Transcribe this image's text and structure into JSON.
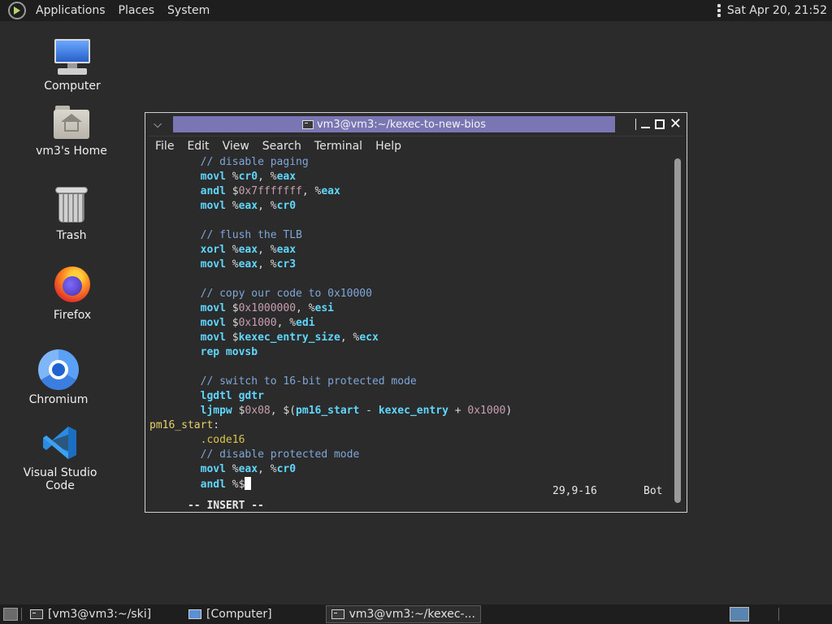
{
  "top_panel": {
    "menus": [
      "Applications",
      "Places",
      "System"
    ],
    "clock": "Sat Apr 20, 21:52"
  },
  "desktop_icons": {
    "computer": "Computer",
    "home": "vm3's Home",
    "trash": "Trash",
    "firefox": "Firefox",
    "chromium": "Chromium",
    "vscode": "Visual Studio Code"
  },
  "terminal": {
    "title": "vm3@vm3:~/kexec-to-new-bios",
    "menu": [
      "File",
      "Edit",
      "View",
      "Search",
      "Terminal",
      "Help"
    ],
    "lines": [
      [
        {
          "t": "        ",
          "c": "plain"
        },
        {
          "t": "// disable paging",
          "c": "comment"
        }
      ],
      [
        {
          "t": "        ",
          "c": "plain"
        },
        {
          "t": "movl",
          "c": "kw"
        },
        {
          "t": " %",
          "c": "plain"
        },
        {
          "t": "cr0",
          "c": "reg"
        },
        {
          "t": ", %",
          "c": "plain"
        },
        {
          "t": "eax",
          "c": "reg"
        }
      ],
      [
        {
          "t": "        ",
          "c": "plain"
        },
        {
          "t": "andl",
          "c": "kw"
        },
        {
          "t": " $",
          "c": "plain"
        },
        {
          "t": "0x7fffffff",
          "c": "num"
        },
        {
          "t": ", %",
          "c": "plain"
        },
        {
          "t": "eax",
          "c": "reg"
        }
      ],
      [
        {
          "t": "        ",
          "c": "plain"
        },
        {
          "t": "movl",
          "c": "kw"
        },
        {
          "t": " %",
          "c": "plain"
        },
        {
          "t": "eax",
          "c": "reg"
        },
        {
          "t": ", %",
          "c": "plain"
        },
        {
          "t": "cr0",
          "c": "reg"
        }
      ],
      [],
      [
        {
          "t": "        ",
          "c": "plain"
        },
        {
          "t": "// flush the TLB",
          "c": "comment"
        }
      ],
      [
        {
          "t": "        ",
          "c": "plain"
        },
        {
          "t": "xorl",
          "c": "kw"
        },
        {
          "t": " %",
          "c": "plain"
        },
        {
          "t": "eax",
          "c": "reg"
        },
        {
          "t": ", %",
          "c": "plain"
        },
        {
          "t": "eax",
          "c": "reg"
        }
      ],
      [
        {
          "t": "        ",
          "c": "plain"
        },
        {
          "t": "movl",
          "c": "kw"
        },
        {
          "t": " %",
          "c": "plain"
        },
        {
          "t": "eax",
          "c": "reg"
        },
        {
          "t": ", %",
          "c": "plain"
        },
        {
          "t": "cr3",
          "c": "reg"
        }
      ],
      [],
      [
        {
          "t": "        ",
          "c": "plain"
        },
        {
          "t": "// copy our code to 0x10000",
          "c": "comment"
        }
      ],
      [
        {
          "t": "        ",
          "c": "plain"
        },
        {
          "t": "movl",
          "c": "kw"
        },
        {
          "t": " $",
          "c": "plain"
        },
        {
          "t": "0x1000000",
          "c": "num"
        },
        {
          "t": ", %",
          "c": "plain"
        },
        {
          "t": "esi",
          "c": "reg"
        }
      ],
      [
        {
          "t": "        ",
          "c": "plain"
        },
        {
          "t": "movl",
          "c": "kw"
        },
        {
          "t": " $",
          "c": "plain"
        },
        {
          "t": "0x1000",
          "c": "num"
        },
        {
          "t": ", %",
          "c": "plain"
        },
        {
          "t": "edi",
          "c": "reg"
        }
      ],
      [
        {
          "t": "        ",
          "c": "plain"
        },
        {
          "t": "movl",
          "c": "kw"
        },
        {
          "t": " $",
          "c": "plain"
        },
        {
          "t": "kexec_entry_size",
          "c": "reg"
        },
        {
          "t": ", %",
          "c": "plain"
        },
        {
          "t": "ecx",
          "c": "reg"
        }
      ],
      [
        {
          "t": "        ",
          "c": "plain"
        },
        {
          "t": "rep movsb",
          "c": "kw"
        }
      ],
      [],
      [
        {
          "t": "        ",
          "c": "plain"
        },
        {
          "t": "// switch to 16-bit protected mode",
          "c": "comment"
        }
      ],
      [
        {
          "t": "        ",
          "c": "plain"
        },
        {
          "t": "lgdtl gdtr",
          "c": "kw"
        }
      ],
      [
        {
          "t": "        ",
          "c": "plain"
        },
        {
          "t": "ljmpw",
          "c": "kw"
        },
        {
          "t": " $",
          "c": "plain"
        },
        {
          "t": "0x08",
          "c": "num"
        },
        {
          "t": ", $(",
          "c": "plain"
        },
        {
          "t": "pm16_start",
          "c": "reg"
        },
        {
          "t": " - ",
          "c": "plain"
        },
        {
          "t": "kexec_entry",
          "c": "reg"
        },
        {
          "t": " + ",
          "c": "plain"
        },
        {
          "t": "0x1000",
          "c": "num"
        },
        {
          "t": ")",
          "c": "plain"
        }
      ],
      [
        {
          "t": "pm16_start",
          "c": "label"
        },
        {
          "t": ":",
          "c": "plain"
        }
      ],
      [
        {
          "t": "        ",
          "c": "plain"
        },
        {
          "t": ".code16",
          "c": "dir"
        }
      ],
      [
        {
          "t": "        ",
          "c": "plain"
        },
        {
          "t": "// disable protected mode",
          "c": "comment"
        }
      ],
      [
        {
          "t": "        ",
          "c": "plain"
        },
        {
          "t": "movl",
          "c": "kw"
        },
        {
          "t": " %",
          "c": "plain"
        },
        {
          "t": "eax",
          "c": "reg"
        },
        {
          "t": ", %",
          "c": "plain"
        },
        {
          "t": "cr0",
          "c": "reg"
        }
      ],
      [
        {
          "t": "        ",
          "c": "plain"
        },
        {
          "t": "andl",
          "c": "kw"
        },
        {
          "t": " %$",
          "c": "plain"
        }
      ]
    ],
    "status": {
      "mode": "-- INSERT --",
      "position": "29,9-16",
      "where": "Bot"
    }
  },
  "bottom_panel": {
    "tasks": [
      "[vm3@vm3:~/ski]",
      "[Computer]",
      "vm3@vm3:~/kexec-..."
    ]
  }
}
